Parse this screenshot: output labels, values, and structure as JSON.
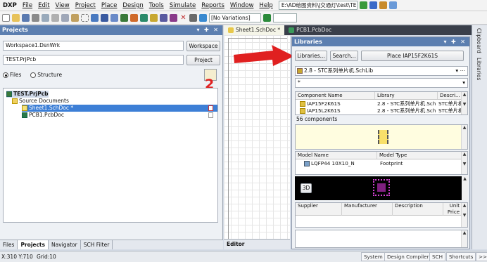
{
  "menu": {
    "app": "DXP",
    "items": [
      "File",
      "Edit",
      "View",
      "Project",
      "Place",
      "Design",
      "Tools",
      "Simulate",
      "Reports",
      "Window",
      "Help"
    ],
    "path": "E:\\AD绘图资料\\J交通灯\\test\\TES"
  },
  "toolbar": {
    "variations": "[No Variations]"
  },
  "projects_panel": {
    "title": "Projects",
    "controls": "▾ ✚ ✕",
    "workspace_value": "Workspace1.DsnWrk",
    "workspace_button": "Workspace",
    "project_value": "TEST.PrjPcb",
    "project_button": "Project",
    "radio_files": "Files",
    "radio_structure": "Structure",
    "tree": [
      {
        "label": "TEST.PrjPcb",
        "indent": 0
      },
      {
        "label": "Source Documents",
        "indent": 1
      },
      {
        "label": "Sheet1.SchDoc *",
        "indent": 2,
        "selected": true
      },
      {
        "label": "PCB1.PcbDoc",
        "indent": 2
      }
    ],
    "bottom_tabs": [
      "Files",
      "Projects",
      "Navigator",
      "SCH Filter"
    ],
    "active_tab": "Projects"
  },
  "doc_tabs": [
    "Sheet1.SchDoc *",
    "PCB1.PcbDoc"
  ],
  "editor_label": "Editor",
  "annotation_number": "2",
  "libraries": {
    "title": "Libraries",
    "controls": "▾ ✚ ✕",
    "btn_libraries": "Libraries...",
    "btn_search": "Search...",
    "btn_place": "Place IAP15F2K61S",
    "lib_selected": "2.8 - STC系列单片机.SchLib",
    "filter_value": "*",
    "comp_headers": [
      "Component Name",
      "Library",
      "Descri..."
    ],
    "components": [
      {
        "name": "IAP15F2K61S",
        "library": "2.8 - STC系列单片机.Sch",
        "desc": "STC单片机"
      },
      {
        "name": "IAP15L2K61S",
        "library": "2.8 - STC系列单片机.Sch",
        "desc": "STC单片机"
      }
    ],
    "comp_count": "56 components",
    "model_headers": [
      "Model Name",
      "Model Type"
    ],
    "models": [
      {
        "name": "LQFP44 10X10_N",
        "type": "Footprint"
      }
    ],
    "btn_3d": "3D",
    "supplier_headers": [
      "Supplier",
      "Manufacturer",
      "Description",
      "Unit Price"
    ]
  },
  "right_strip": [
    "Clipboard",
    "Libraries"
  ],
  "status": {
    "coords": "X:310 Y:710",
    "grid": "Grid:10",
    "pills": [
      "System",
      "Design Compiler",
      "SCH",
      "Shortcuts",
      ">>"
    ]
  },
  "colors": {
    "panel_header": "#5c7fb0",
    "selection": "#3d7fd6",
    "arrow": "#e02020"
  }
}
